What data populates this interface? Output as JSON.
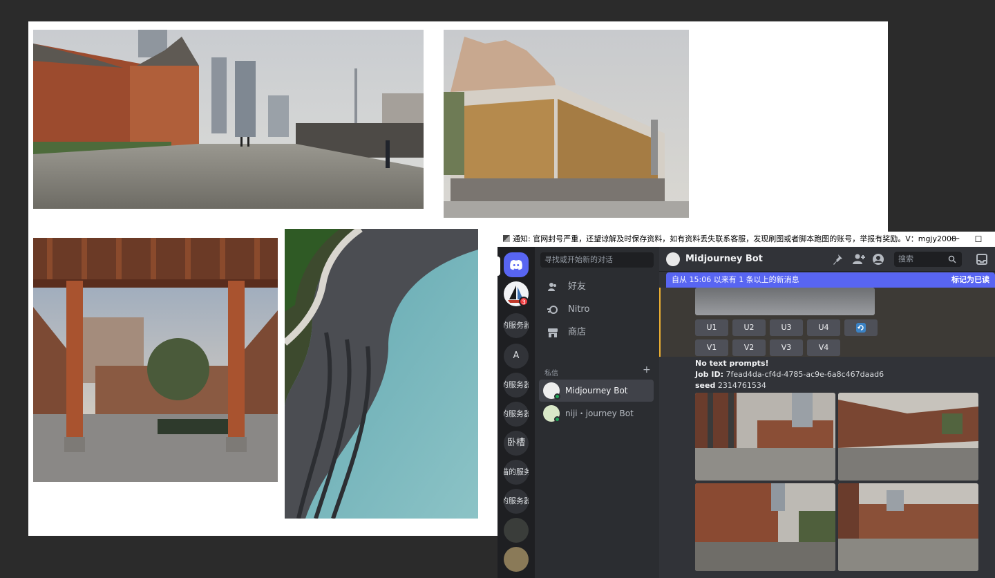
{
  "discord": {
    "notice": "通知: 官网封号严重，还望谅解及时保存资料，如有资料丢失联系客服，发现刷图或者脚本跑图的账号，举报有奖励。V：mgjy2008",
    "window_min": "—",
    "window_max": "☐",
    "servers": {
      "badge_count": "3",
      "s1": "的服务器",
      "s2": "A",
      "s3": "的服务器",
      "s4": "的服务器",
      "s5": "卧槽",
      "s6": "猫的服务器",
      "s7": "的服务器"
    },
    "dm_panel": {
      "search_placeholder": "寻找或开始新的对话",
      "nav_friends": "好友",
      "nav_nitro": "Nitro",
      "nav_shop": "商店",
      "section_label": "私信",
      "add_symbol": "+",
      "dm_items": [
        {
          "label": "Midjourney Bot"
        },
        {
          "label": "niji・journey Bot"
        }
      ]
    },
    "chat": {
      "title": "Midjourney Bot",
      "search_placeholder": "搜索",
      "new_messages": "自从 15:06 以来有 1 条以上的新消息",
      "mark_read": "标记为已读",
      "upscale_buttons": [
        "U1",
        "U2",
        "U3",
        "U4"
      ],
      "variation_buttons": [
        "V1",
        "V2",
        "V3",
        "V4"
      ],
      "prompt_line": "No text prompts!",
      "job_id_label": "Job ID:",
      "job_id": "7fead4da-cf4d-4785-ac9e-6a8c467daad6",
      "seed_label": "seed",
      "seed": "2314761534"
    },
    "colors": {
      "blurple": "#5865f2",
      "rail_bg": "#1e1f22",
      "panel_bg": "#2b2d31",
      "chat_bg": "#313338",
      "online": "#23a55a",
      "badge": "#f23f43"
    }
  },
  "icons": [
    "discord-logo-icon",
    "friends-icon",
    "nitro-icon",
    "shop-icon",
    "pin-icon",
    "add-friend-icon",
    "profile-icon",
    "search-icon",
    "inbox-icon",
    "reroll-icon"
  ]
}
